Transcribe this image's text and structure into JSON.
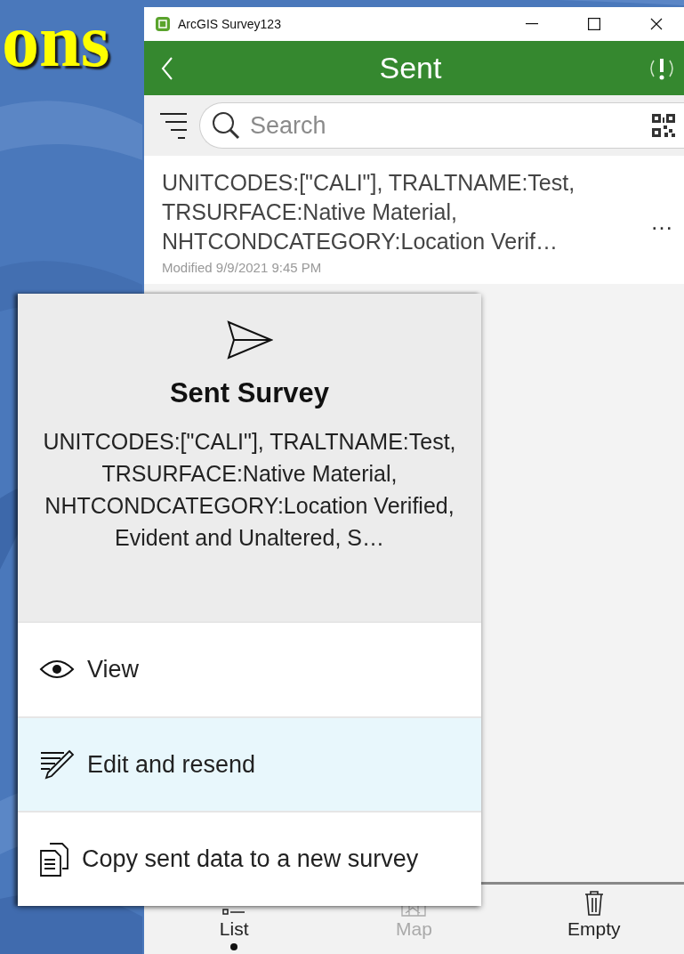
{
  "slide": {
    "title": "ons"
  },
  "window": {
    "title": "ArcGIS Survey123"
  },
  "header": {
    "title": "Sent"
  },
  "search": {
    "placeholder": "Search"
  },
  "list_items": [
    {
      "text": "UNITCODES:[\"CALI\"], TRALTNAME:Test, TRSURFACE:Native Material, NHTCONDCATEGORY:Location Verif…",
      "modified": "Modified 9/9/2021 9:45 PM",
      "menu": "…"
    }
  ],
  "popup": {
    "title": "Sent Survey",
    "description": "UNITCODES:[\"CALI\"], TRALTNAME:Test, TRSURFACE:Native Material, NHTCONDCATEGORY:Location Verified, Evident and Unaltered, S…",
    "actions": [
      {
        "kind": "view",
        "label": "View",
        "selected": false
      },
      {
        "kind": "edit",
        "label": "Edit and resend",
        "selected": true
      },
      {
        "kind": "copy",
        "label": "Copy sent data to a new survey",
        "selected": false
      }
    ]
  },
  "tabs": [
    {
      "kind": "list",
      "label": "List",
      "selected": true,
      "disabled": false
    },
    {
      "kind": "map",
      "label": "Map",
      "selected": false,
      "disabled": true
    },
    {
      "kind": "empty",
      "label": "Empty",
      "selected": false,
      "disabled": false
    }
  ]
}
